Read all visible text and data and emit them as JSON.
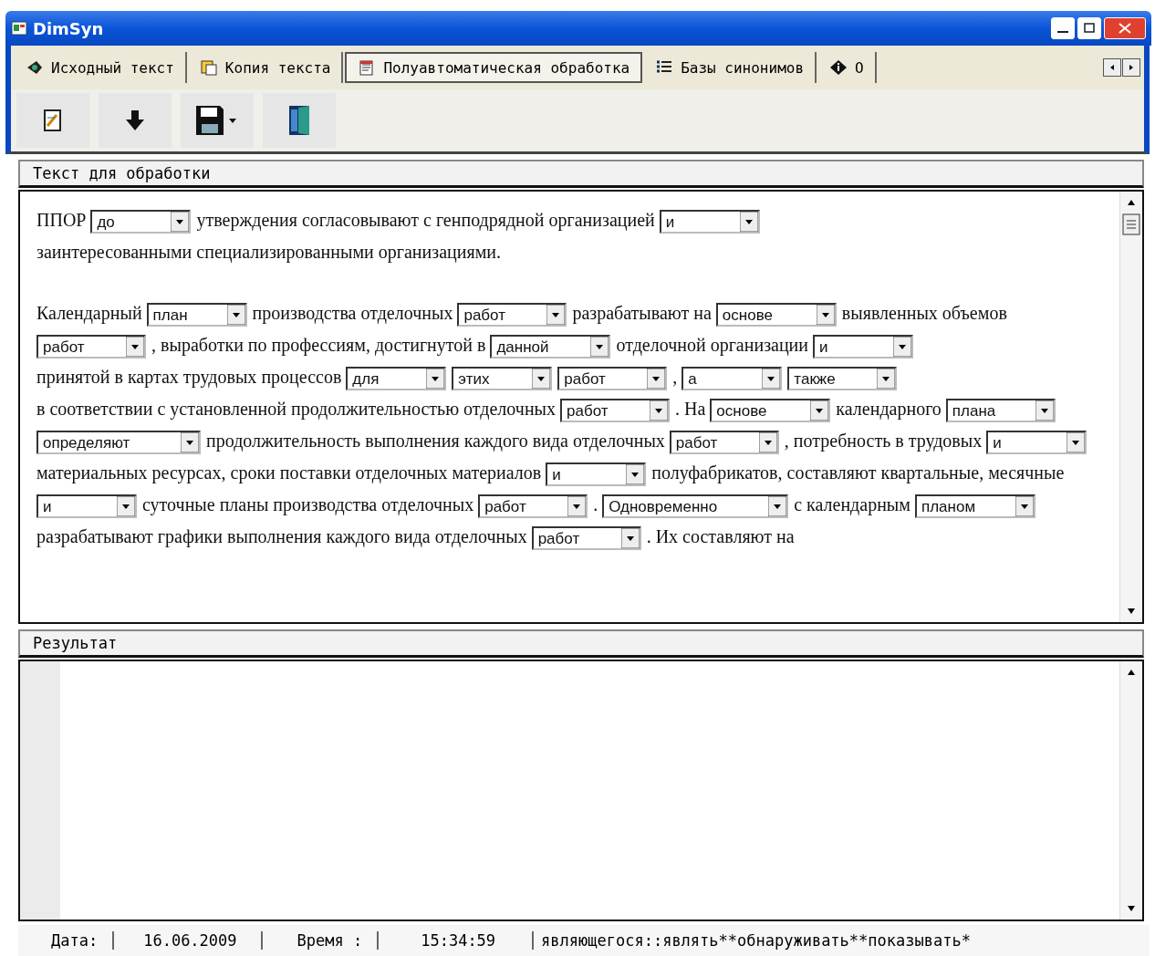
{
  "window": {
    "title": "DimSyn"
  },
  "tabs": [
    {
      "label": "Исходный текст",
      "selected": false
    },
    {
      "label": "Копия текста",
      "selected": false
    },
    {
      "label": "Полуавтоматическая обработка",
      "selected": true
    },
    {
      "label": "Базы синонимов",
      "selected": false
    },
    {
      "label": "О",
      "selected": false
    }
  ],
  "toolbar": [
    {
      "kind": "edit"
    },
    {
      "kind": "down"
    },
    {
      "kind": "save"
    },
    {
      "kind": "exit"
    }
  ],
  "source_panel": {
    "header": "Текст для обработки",
    "paragraphs": [
      [
        {
          "kind": "text",
          "text": "ППОР"
        },
        {
          "kind": "combo",
          "value": "до"
        },
        {
          "kind": "text",
          "text": "утверждения согласовывают с генподрядной организацией"
        },
        {
          "kind": "combo",
          "value": "и"
        },
        {
          "kind": "text",
          "text": "заинтересованными специализированными организациями."
        }
      ],
      [
        {
          "kind": "text",
          "text": "Календарный"
        },
        {
          "kind": "combo",
          "value": "план"
        },
        {
          "kind": "text",
          "text": "производства отделочных"
        },
        {
          "kind": "combo",
          "value": "работ"
        },
        {
          "kind": "text",
          "text": "разрабатывают на"
        },
        {
          "kind": "combo",
          "value": "основе"
        },
        {
          "kind": "text",
          "text": "выявленных объемов"
        },
        {
          "kind": "combo",
          "value": "работ"
        },
        {
          "kind": "text",
          "text": ", выработки по профессиям, достигнутой в"
        },
        {
          "kind": "combo",
          "value": "данной"
        },
        {
          "kind": "text",
          "text": "отделочной организации"
        },
        {
          "kind": "combo",
          "value": "и"
        },
        {
          "kind": "text",
          "text": "принятой в картах трудовых процессов"
        },
        {
          "kind": "combo",
          "value": "для"
        },
        {
          "kind": "combo",
          "value": "этих"
        },
        {
          "kind": "combo",
          "value": "работ"
        },
        {
          "kind": "text",
          "text": ","
        },
        {
          "kind": "combo",
          "value": "а"
        },
        {
          "kind": "combo",
          "value": "также"
        },
        {
          "kind": "text",
          "text": "в соответствии с установленной продолжительностью отделочных"
        },
        {
          "kind": "combo",
          "value": "работ"
        },
        {
          "kind": "text",
          "text": ". На"
        },
        {
          "kind": "combo",
          "value": "основе"
        },
        {
          "kind": "text",
          "text": "календарного"
        },
        {
          "kind": "combo",
          "value": "плана"
        },
        {
          "kind": "combo",
          "value": "определяют"
        },
        {
          "kind": "text",
          "text": "продолжительность выполнения каждого вида отделочных"
        },
        {
          "kind": "combo",
          "value": "работ"
        },
        {
          "kind": "text",
          "text": ", потребность в трудовых"
        },
        {
          "kind": "combo",
          "value": "и"
        },
        {
          "kind": "text",
          "text": "материальных ресурсах, сроки поставки отделочных материалов"
        },
        {
          "kind": "combo",
          "value": "и"
        },
        {
          "kind": "text",
          "text": "полуфабрикатов, составляют квартальные, месячные"
        },
        {
          "kind": "combo",
          "value": "и"
        },
        {
          "kind": "text",
          "text": "суточные планы производства отделочных"
        },
        {
          "kind": "combo",
          "value": "работ"
        },
        {
          "kind": "text",
          "text": "."
        },
        {
          "kind": "combo",
          "value": "Одновременно"
        },
        {
          "kind": "text",
          "text": "с календарным"
        },
        {
          "kind": "combo",
          "value": "планом"
        },
        {
          "kind": "text",
          "text": "разрабатывают графики выполнения каждого вида отделочных"
        },
        {
          "kind": "combo",
          "value": "работ"
        },
        {
          "kind": "text",
          "text": ". Их составляют на"
        }
      ]
    ]
  },
  "result_panel": {
    "header": "Результат"
  },
  "status_bar": [
    {
      "label": "Дата:"
    },
    {
      "label": "16.06.2009"
    },
    {
      "label": "Время :"
    },
    {
      "label": "15:34:59"
    },
    {
      "label": "являющегося::являть**обнаруживать**показывать*"
    }
  ]
}
